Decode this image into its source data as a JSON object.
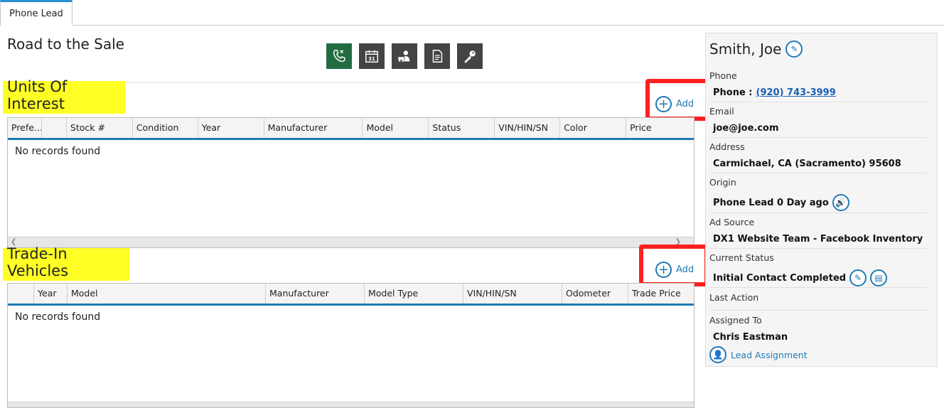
{
  "tabs": [
    {
      "label": "Phone Lead"
    }
  ],
  "page_title": "Road to the Sale",
  "toolbar": {
    "icons": [
      "phone-icon",
      "calendar-icon",
      "customer-vehicle-icon",
      "document-icon",
      "key-icon"
    ],
    "calendar_day": "31",
    "active_color": "#236c42",
    "icon_bg": "#444444"
  },
  "units_of_interest": {
    "title": "Units Of Interest",
    "add_label": "Add",
    "columns": [
      "Prefe...",
      "",
      "Stock #",
      "Condition",
      "Year",
      "Manufacturer",
      "Model",
      "Status",
      "VIN/HIN/SN",
      "Color",
      "Price"
    ],
    "empty_text": "No records found"
  },
  "trade_in": {
    "title": "Trade-In Vehicles",
    "add_label": "Add",
    "columns": [
      "",
      "Year",
      "Model",
      "Manufacturer",
      "Model Type",
      "VIN/HIN/SN",
      "Odometer",
      "Trade Price"
    ],
    "empty_text": "No records found"
  },
  "customer": {
    "name": "Smith, Joe",
    "phone_label": "Phone",
    "phone_prefix": "Phone :",
    "phone_number": "(920) 743-3999",
    "email_label": "Email",
    "email": "joe@joe.com",
    "address_label": "Address",
    "address": "Carmichael, CA (Sacramento) 95608",
    "origin_label": "Origin",
    "origin": "Phone Lead 0 Day ago",
    "ad_source_label": "Ad Source",
    "ad_source": "DX1 Website Team - Facebook Inventory",
    "status_label": "Current Status",
    "status": "Initial Contact Completed",
    "last_action_label": "Last Action",
    "assigned_label": "Assigned To",
    "assigned_to": "Chris Eastman",
    "lead_assignment_link": "Lead Assignment"
  },
  "colors": {
    "accent": "#1f7bb6",
    "highlight": "#ffff26",
    "annotation_box": "#ff1f1f"
  }
}
